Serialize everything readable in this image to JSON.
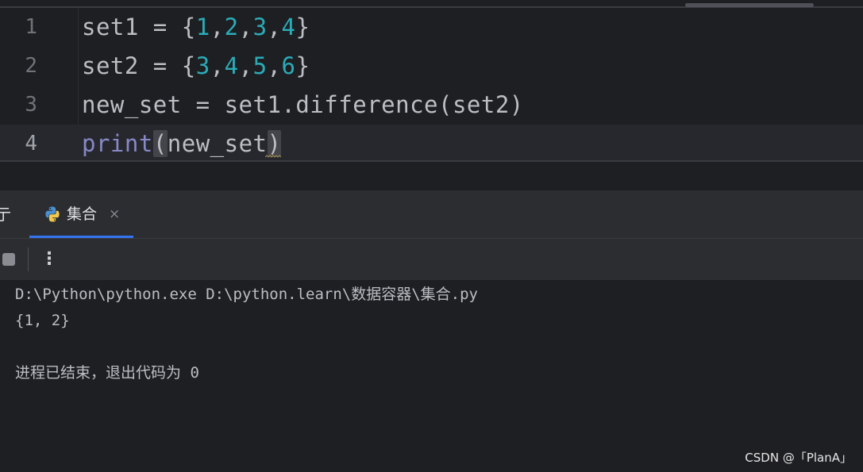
{
  "editor": {
    "lines": [
      {
        "number": "1",
        "tokens": [
          {
            "text": "set1 = {",
            "type": "plain"
          },
          {
            "text": "1",
            "type": "num"
          },
          {
            "text": ",",
            "type": "plain"
          },
          {
            "text": "2",
            "type": "num"
          },
          {
            "text": ",",
            "type": "plain"
          },
          {
            "text": "3",
            "type": "num"
          },
          {
            "text": ",",
            "type": "plain"
          },
          {
            "text": "4",
            "type": "num"
          },
          {
            "text": "}",
            "type": "plain"
          }
        ]
      },
      {
        "number": "2",
        "tokens": [
          {
            "text": "set2 = {",
            "type": "plain"
          },
          {
            "text": "3",
            "type": "num"
          },
          {
            "text": ",",
            "type": "plain"
          },
          {
            "text": "4",
            "type": "num"
          },
          {
            "text": ",",
            "type": "plain"
          },
          {
            "text": "5",
            "type": "num"
          },
          {
            "text": ",",
            "type": "plain"
          },
          {
            "text": "6",
            "type": "num"
          },
          {
            "text": "}",
            "type": "plain"
          }
        ]
      },
      {
        "number": "3",
        "tokens": [
          {
            "text": "new_set = set1.difference(set2)",
            "type": "plain"
          }
        ]
      },
      {
        "number": "4",
        "current": true,
        "tokens": [
          {
            "text": "print",
            "type": "builtin"
          },
          {
            "text": "(",
            "type": "brace"
          },
          {
            "text": "new_set",
            "type": "plain"
          },
          {
            "text": ")",
            "type": "brace"
          }
        ]
      }
    ]
  },
  "toolwindow": {
    "prev_tab_label": "亍",
    "active_tab": {
      "label": "集合",
      "icon": "python-icon",
      "close_glyph": "×"
    },
    "toolbar": {
      "stop_icon": "stop-icon",
      "more_glyph": "⋮"
    }
  },
  "console": {
    "lines": [
      "D:\\Python\\python.exe D:\\python.learn\\数据容器\\集合.py",
      "{1, 2}",
      "",
      "进程已结束，退出代码为 0"
    ]
  },
  "watermark": "CSDN @「PlanA」",
  "colors": {
    "background": "#1e1f22",
    "panel": "#2b2d30",
    "number_literal": "#2aacb8",
    "builtin": "#8888c6",
    "accent": "#3574f0"
  }
}
